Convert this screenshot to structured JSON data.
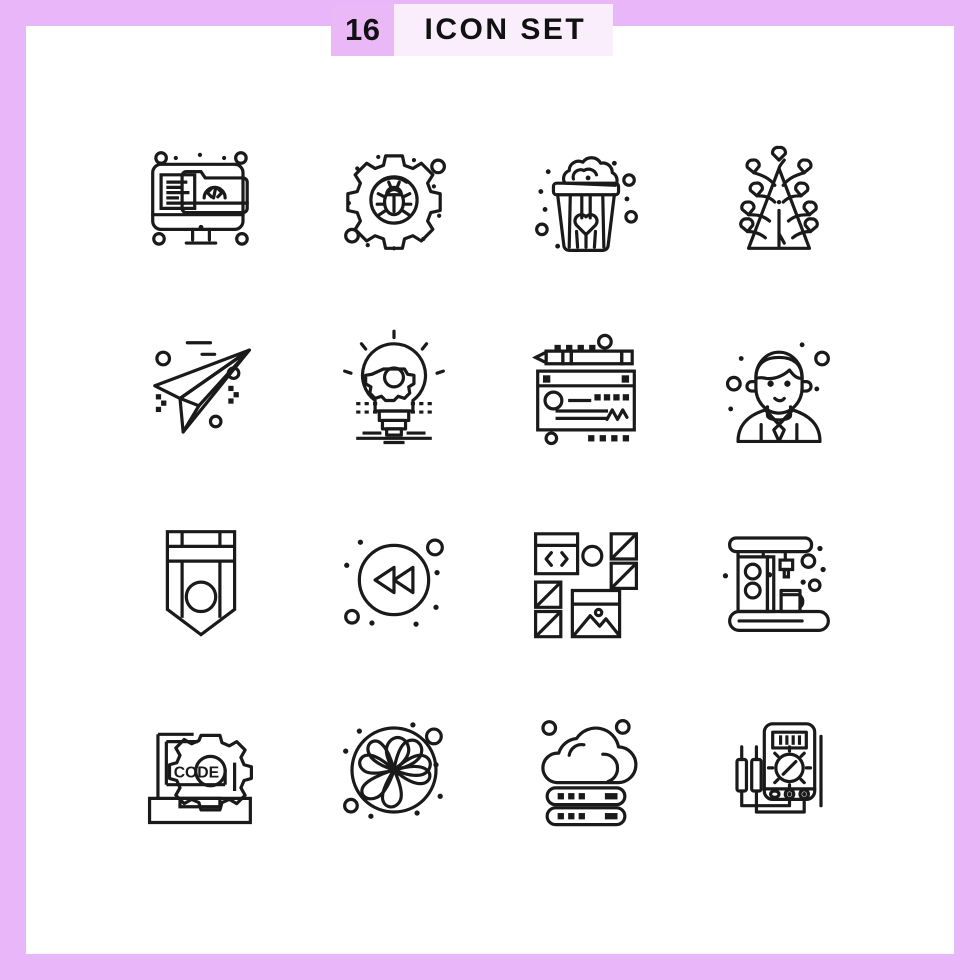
{
  "poster": {
    "border_color": "#e8b6f9",
    "background_color": "#ffffff",
    "stroke_color": "#1a1a1a"
  },
  "header": {
    "count": "16",
    "title": "ICON SET",
    "count_badge_color": "#eab8f7",
    "title_plate_color": "#faeefd"
  },
  "grid": {
    "columns": 4,
    "rows": 4,
    "style": "outline",
    "icons": [
      {
        "position": 1,
        "name": "computer-code-folder-icon",
        "label": "Computer Code Folder"
      },
      {
        "position": 2,
        "name": "bug-gear-icon",
        "label": "Bug Settings"
      },
      {
        "position": 3,
        "name": "popcorn-heart-icon",
        "label": "Popcorn"
      },
      {
        "position": 4,
        "name": "love-tree-icon",
        "label": "Love Tree"
      },
      {
        "position": 5,
        "name": "paper-plane-icon",
        "label": "Paper Plane"
      },
      {
        "position": 6,
        "name": "lightbulb-gear-icon",
        "label": "Idea Settings"
      },
      {
        "position": 7,
        "name": "cheque-pencil-icon",
        "label": "Cheque"
      },
      {
        "position": 8,
        "name": "businessman-avatar-icon",
        "label": "Businessman"
      },
      {
        "position": 9,
        "name": "badge-emblem-icon",
        "label": "Badge"
      },
      {
        "position": 10,
        "name": "rewind-button-icon",
        "label": "Rewind"
      },
      {
        "position": 11,
        "name": "web-layout-grid-icon",
        "label": "Web Layout"
      },
      {
        "position": 12,
        "name": "coffee-machine-icon",
        "label": "Coffee Machine"
      },
      {
        "position": 13,
        "name": "laptop-code-gear-icon",
        "label": "Code Laptop"
      },
      {
        "position": 14,
        "name": "flower-fan-icon",
        "label": "Flower Fan"
      },
      {
        "position": 15,
        "name": "cloud-server-icon",
        "label": "Cloud Server"
      },
      {
        "position": 16,
        "name": "multimeter-icon",
        "label": "Multimeter"
      }
    ]
  }
}
